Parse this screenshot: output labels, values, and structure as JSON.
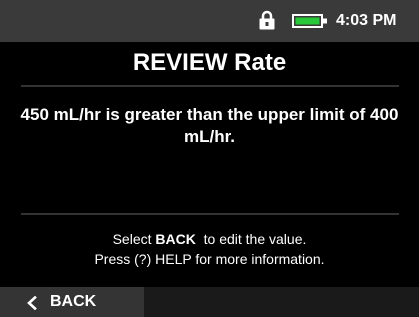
{
  "status_bar": {
    "time": "4:03 PM",
    "lock_icon": "lock-icon",
    "battery_icon": "battery-icon",
    "battery_color": "#28c83a"
  },
  "screen": {
    "title": "REVIEW Rate",
    "message": "450 mL/hr is greater than the upper limit of 400 mL/hr."
  },
  "instructions": {
    "line1_prefix": "Select ",
    "line1_key": "BACK",
    "line1_suffix": "  to edit the value.",
    "line2": "Press (?) HELP for more information."
  },
  "footer": {
    "back_label": "BACK",
    "back_icon": "chevron-left-icon"
  }
}
